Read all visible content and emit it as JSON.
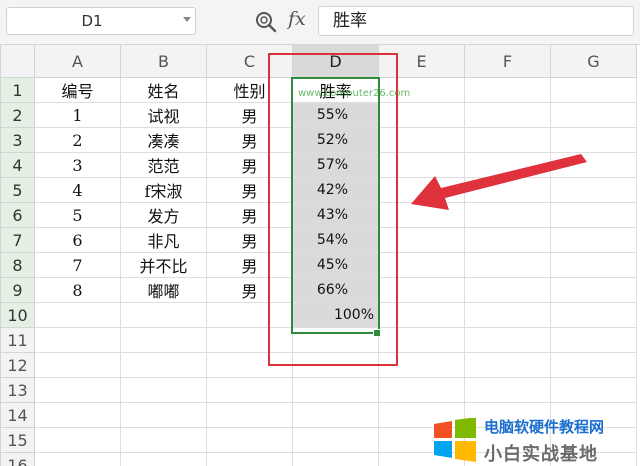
{
  "formula_bar": {
    "name_box": "D1",
    "fx_icon": "fx",
    "formula": "胜率"
  },
  "columns": [
    "A",
    "B",
    "C",
    "D",
    "E",
    "F",
    "G"
  ],
  "row_numbers": [
    "1",
    "2",
    "3",
    "4",
    "5",
    "6",
    "7",
    "8",
    "9",
    "10",
    "11",
    "12",
    "13",
    "14",
    "15",
    "16"
  ],
  "sheet": {
    "headers": [
      "编号",
      "姓名",
      "性别",
      "胜率"
    ],
    "rows": [
      [
        "1",
        "试视",
        "男",
        "55%"
      ],
      [
        "2",
        "凑凑",
        "男",
        "52%"
      ],
      [
        "3",
        "范范",
        "男",
        "57%"
      ],
      [
        "4",
        "f宋淑",
        "男",
        "42%"
      ],
      [
        "5",
        "发方",
        "男",
        "43%"
      ],
      [
        "6",
        "非凡",
        "男",
        "54%"
      ],
      [
        "7",
        "并不比",
        "男",
        "45%"
      ],
      [
        "8",
        "嘟嘟",
        "男",
        "66%"
      ]
    ],
    "total": "100%"
  },
  "watermark": {
    "line1": "电脑软硬件教程网",
    "line2": "小白实战基地",
    "url": "www.computer26.com"
  },
  "colors": {
    "selection": "#2e8b3a",
    "highlight_box": "#d9323b",
    "arrow": "#e0323d",
    "selected_fill": "#dadada"
  },
  "icons": {
    "zoom": "magnifier-icon",
    "fx": "fx-icon",
    "dropdown": "chevron-down-icon"
  }
}
